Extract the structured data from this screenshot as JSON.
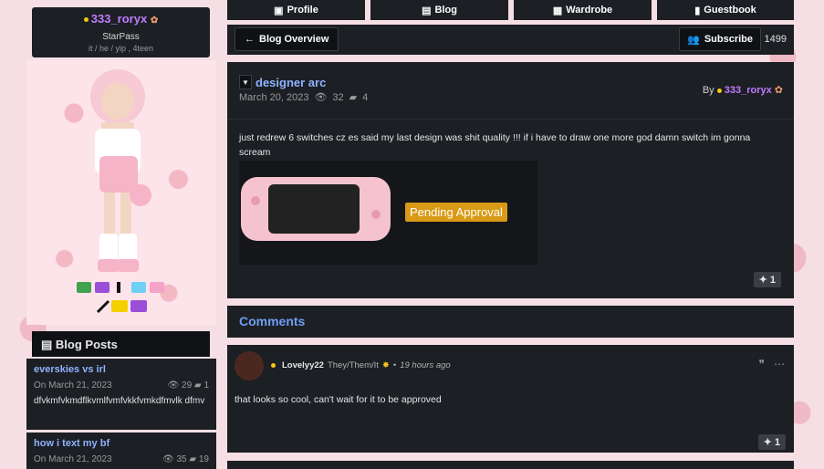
{
  "profile": {
    "username": "333_roryx",
    "rank": "StarPass",
    "pronouns": "it / he / yip , 4teen"
  },
  "tabs": [
    {
      "label": "Profile",
      "icon": "id-card-icon"
    },
    {
      "label": "Blog",
      "icon": "blog-icon"
    },
    {
      "label": "Wardrobe",
      "icon": "wardrobe-icon"
    },
    {
      "label": "Guestbook",
      "icon": "guestbook-icon"
    }
  ],
  "overview": {
    "back_label": "Blog Overview",
    "subscribe_label": "Subscribe",
    "subscriber_count": "1499"
  },
  "post": {
    "title": "designer arc",
    "date": "March 20, 2023",
    "views": "32",
    "comments": "4",
    "by_label": "By",
    "author": "333_roryx",
    "body": "just redrew 6 switches cz es said my last design was shit quality !!! if i have to draw one more god damn switch im gonna scream",
    "image_badge": "Pending Approval",
    "likes": "1"
  },
  "sidebar": {
    "blog_posts_label": "Blog Posts",
    "posts": [
      {
        "title": "everskies vs irl",
        "date": "On March 21, 2023",
        "views": "29",
        "comments": "1",
        "body": "dfvkmfvkmdflkvmlfvmfvkkfvmkdfmvlk dfmv"
      },
      {
        "title": "how i text my bf",
        "date": "On March 21, 2023",
        "views": "35",
        "comments": "19",
        "body": ""
      }
    ]
  },
  "comments": {
    "heading": "Comments",
    "items": [
      {
        "user": "Lovelyy22",
        "pronouns": "They/Them/It",
        "time": "19 hours ago",
        "text": "that looks so cool, can't wait for it to be approved",
        "likes": "1"
      }
    ]
  },
  "colors": {
    "accent": "#8fb3ff",
    "panel": "#1c1f24",
    "pending": "#d99a16",
    "username": "#c07cff"
  }
}
